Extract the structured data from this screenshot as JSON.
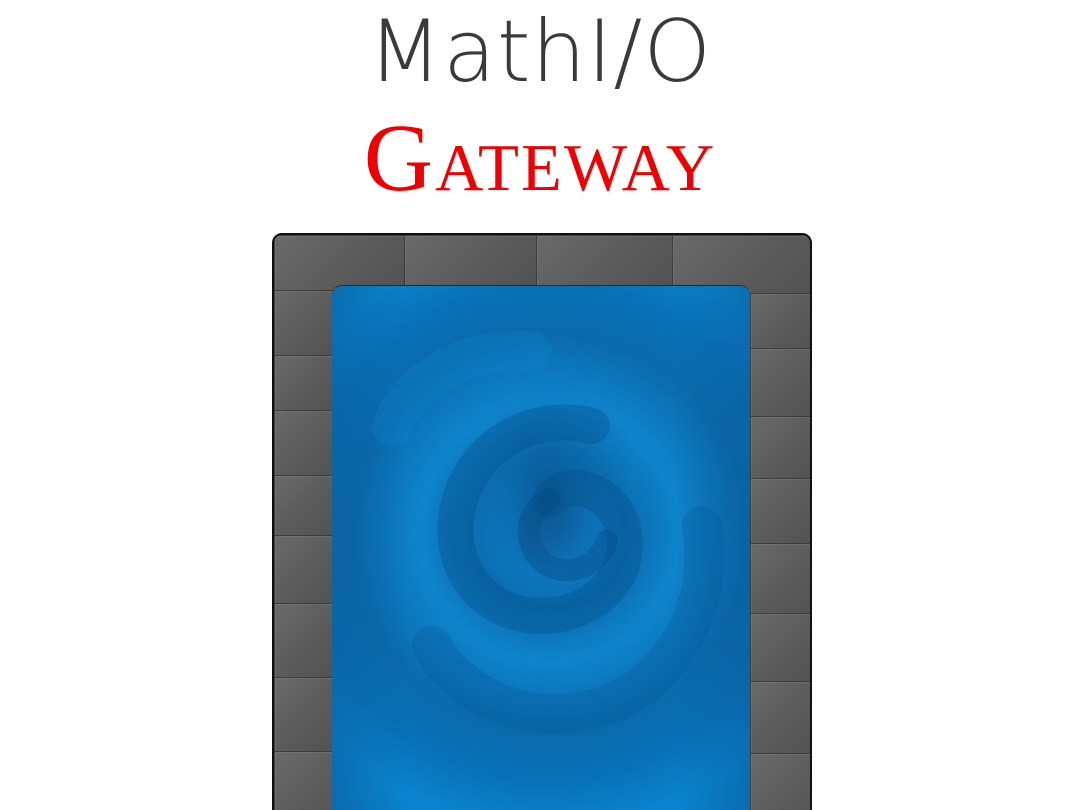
{
  "header": {
    "title_line1": "MathI/O",
    "title_line2": "Gateway"
  },
  "colors": {
    "title_line1": "#3a3a3a",
    "title_line2": "#f00000",
    "frame_stone": "#5e5e5e",
    "portal_blue": "#0a7ac4"
  },
  "icons": {
    "portal": "swirl-portal",
    "frame": "stone-gate-frame"
  }
}
